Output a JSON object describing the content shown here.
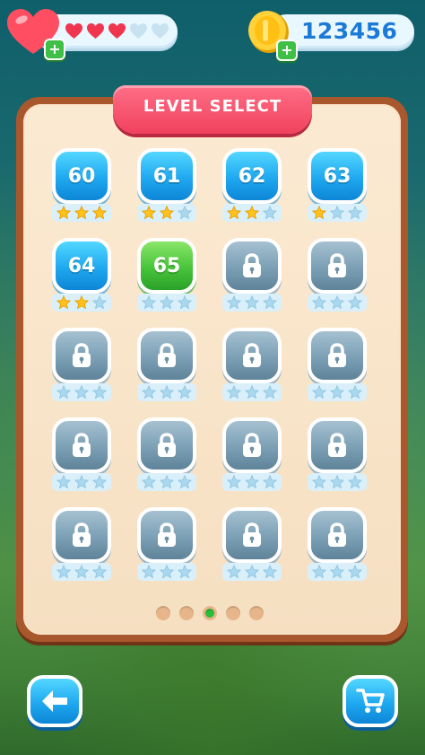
{
  "hud": {
    "lives_count_label": "+",
    "coins_amount": "123456",
    "coins_add_label": "+",
    "hearts": [
      "full",
      "full",
      "full",
      "empty",
      "empty"
    ]
  },
  "title": "LEVEL SELECT",
  "levels": [
    {
      "label": "60",
      "state": "unlocked",
      "stars": 3
    },
    {
      "label": "61",
      "state": "unlocked",
      "stars": 2
    },
    {
      "label": "62",
      "state": "unlocked",
      "stars": 2
    },
    {
      "label": "63",
      "state": "unlocked",
      "stars": 1
    },
    {
      "label": "64",
      "state": "unlocked",
      "stars": 2
    },
    {
      "label": "65",
      "state": "current",
      "stars": 0
    },
    {
      "label": "",
      "state": "locked",
      "stars": 0
    },
    {
      "label": "",
      "state": "locked",
      "stars": 0
    },
    {
      "label": "",
      "state": "locked",
      "stars": 0
    },
    {
      "label": "",
      "state": "locked",
      "stars": 0
    },
    {
      "label": "",
      "state": "locked",
      "stars": 0
    },
    {
      "label": "",
      "state": "locked",
      "stars": 0
    },
    {
      "label": "",
      "state": "locked",
      "stars": 0
    },
    {
      "label": "",
      "state": "locked",
      "stars": 0
    },
    {
      "label": "",
      "state": "locked",
      "stars": 0
    },
    {
      "label": "",
      "state": "locked",
      "stars": 0
    },
    {
      "label": "",
      "state": "locked",
      "stars": 0
    },
    {
      "label": "",
      "state": "locked",
      "stars": 0
    },
    {
      "label": "",
      "state": "locked",
      "stars": 0
    },
    {
      "label": "",
      "state": "locked",
      "stars": 0
    }
  ],
  "pager": {
    "pages": 5,
    "current": 3
  },
  "colors": {
    "accent_blue": "#1fa8f0",
    "accent_green": "#48c43a",
    "ribbon": "#f0415e",
    "frame": "#a9572c"
  },
  "buttons": {
    "back_icon": "arrow-left-icon",
    "shop_icon": "cart-icon"
  }
}
